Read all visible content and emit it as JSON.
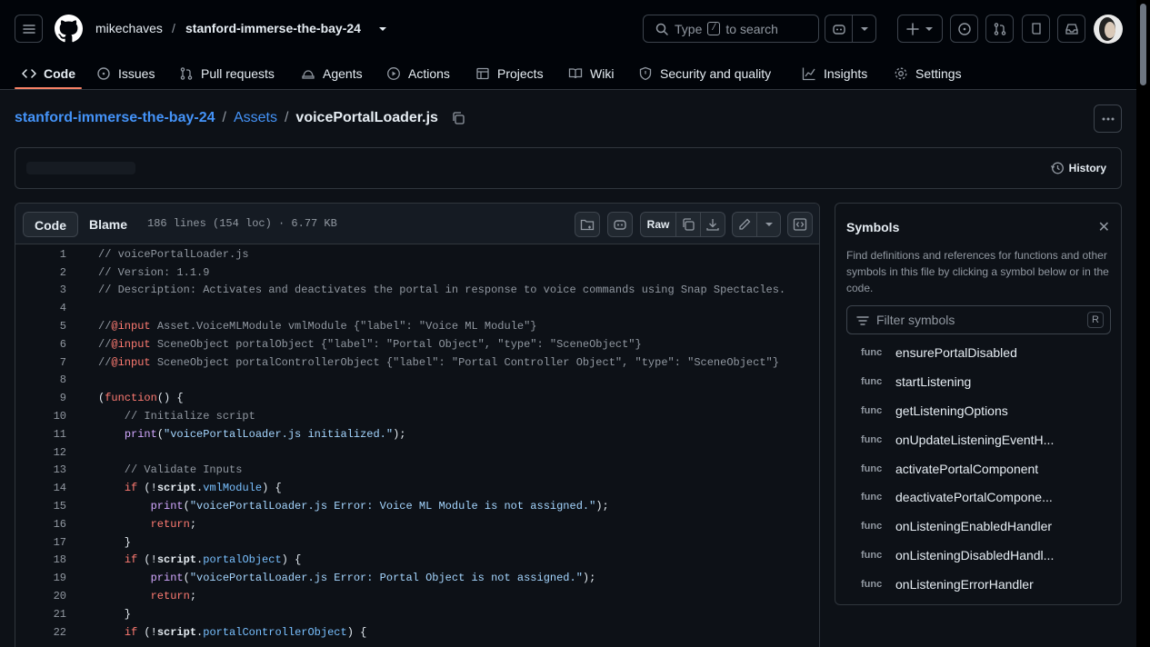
{
  "header": {
    "owner": "mikechaves",
    "separator": "/",
    "repo": "stanford-immerse-the-bay-24",
    "search": {
      "prefix": "Type",
      "key": "/",
      "suffix": "to search"
    }
  },
  "tabs": [
    {
      "label": "Code",
      "icon": "code-icon"
    },
    {
      "label": "Issues",
      "icon": "issue-icon"
    },
    {
      "label": "Pull requests",
      "icon": "pr-icon"
    },
    {
      "label": "Agents",
      "icon": "agent-icon"
    },
    {
      "label": "Actions",
      "icon": "play-icon"
    },
    {
      "label": "Projects",
      "icon": "table-icon"
    },
    {
      "label": "Wiki",
      "icon": "book-icon"
    },
    {
      "label": "Security and quality",
      "icon": "shield-icon"
    },
    {
      "label": "Insights",
      "icon": "graph-icon"
    },
    {
      "label": "Settings",
      "icon": "gear-icon"
    }
  ],
  "breadcrumb": {
    "repo": "stanford-immerse-the-bay-24",
    "folder": "Assets",
    "file": "voicePortalLoader.js",
    "sep": "/"
  },
  "commit": {
    "history_label": "History"
  },
  "file": {
    "view_code": "Code",
    "view_blame": "Blame",
    "info": "186 lines (154 loc) · 6.77 KB",
    "raw_label": "Raw"
  },
  "code_lines": [
    {
      "n": "1",
      "t": "// voicePortalLoader.js"
    },
    {
      "n": "2",
      "t": "// Version: 1.1.9"
    },
    {
      "n": "3",
      "t": "// Description: Activates and deactivates the portal in response to voice commands using Snap Spectacles."
    },
    {
      "n": "4",
      "t": ""
    },
    {
      "n": "5",
      "t": "//@input Asset.VoiceMLModule vmlModule {\"label\": \"Voice ML Module\"}"
    },
    {
      "n": "6",
      "t": "//@input SceneObject portalObject {\"label\": \"Portal Object\", \"type\": \"SceneObject\"}"
    },
    {
      "n": "7",
      "t": "//@input SceneObject portalControllerObject {\"label\": \"Portal Controller Object\", \"type\": \"SceneObject\"}"
    },
    {
      "n": "8",
      "t": ""
    },
    {
      "n": "9",
      "t": "(function() {"
    },
    {
      "n": "10",
      "t": "    // Initialize script"
    },
    {
      "n": "11",
      "t": "    print(\"voicePortalLoader.js initialized.\");"
    },
    {
      "n": "12",
      "t": ""
    },
    {
      "n": "13",
      "t": "    // Validate Inputs"
    },
    {
      "n": "14",
      "t": "    if (!script.vmlModule) {"
    },
    {
      "n": "15",
      "t": "        print(\"voicePortalLoader.js Error: Voice ML Module is not assigned.\");"
    },
    {
      "n": "16",
      "t": "        return;"
    },
    {
      "n": "17",
      "t": "    }"
    },
    {
      "n": "18",
      "t": "    if (!script.portalObject) {"
    },
    {
      "n": "19",
      "t": "        print(\"voicePortalLoader.js Error: Portal Object is not assigned.\");"
    },
    {
      "n": "20",
      "t": "        return;"
    },
    {
      "n": "21",
      "t": "    }"
    },
    {
      "n": "22",
      "t": "    if (!script.portalControllerObject) {"
    }
  ],
  "symbols": {
    "title": "Symbols",
    "description": "Find definitions and references for functions and other symbols in this file by clicking a symbol below or in the code.",
    "filter_placeholder": "Filter symbols",
    "filter_key": "R",
    "items": [
      {
        "kind": "func",
        "name": "ensurePortalDisabled"
      },
      {
        "kind": "func",
        "name": "startListening"
      },
      {
        "kind": "func",
        "name": "getListeningOptions"
      },
      {
        "kind": "func",
        "name": "onUpdateListeningEventH..."
      },
      {
        "kind": "func",
        "name": "activatePortalComponent"
      },
      {
        "kind": "func",
        "name": "deactivatePortalCompone..."
      },
      {
        "kind": "func",
        "name": "onListeningEnabledHandler"
      },
      {
        "kind": "func",
        "name": "onListeningDisabledHandl..."
      },
      {
        "kind": "func",
        "name": "onListeningErrorHandler"
      }
    ]
  }
}
